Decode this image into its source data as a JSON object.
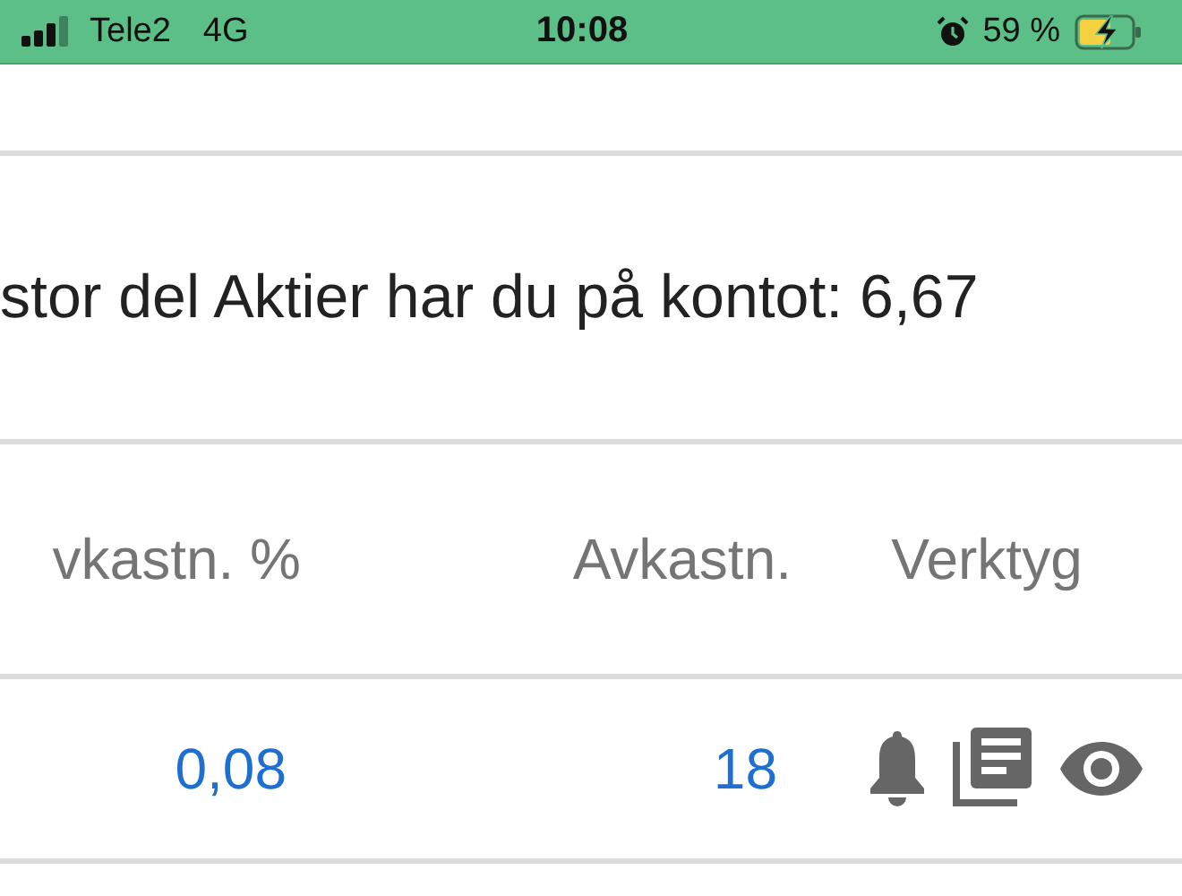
{
  "status_bar": {
    "carrier": "Tele2",
    "network": "4G",
    "time": "10:08",
    "battery": "59 %"
  },
  "summary": "stor del Aktier har du på kontot: 6,67",
  "table": {
    "columns": [
      "vkastn. %",
      "Avkastn.",
      "Verktyg"
    ],
    "rows": [
      {
        "cells": [
          "0,08",
          "18"
        ]
      }
    ]
  }
}
